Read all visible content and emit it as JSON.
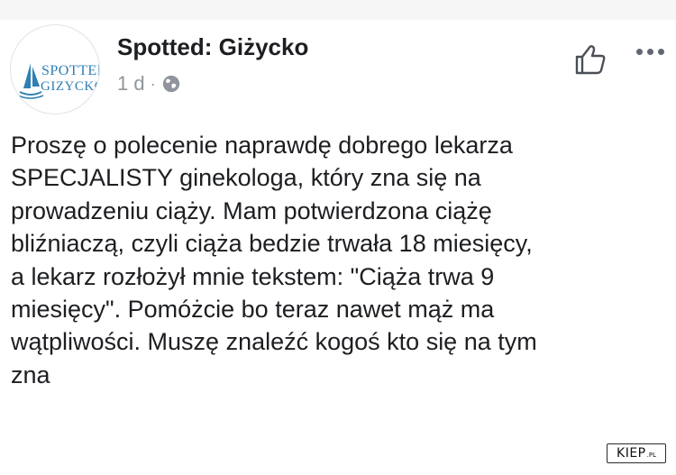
{
  "post": {
    "page_name": "Spotted: Giżycko",
    "time": "1 d",
    "separator": "·",
    "privacy_icon": "globe-icon",
    "avatar": {
      "text_line1": "SPOTTED",
      "text_line2": "GIZYCKO",
      "icon": "sailboat-icon",
      "color": "#2f7fb3"
    },
    "actions": {
      "like_icon": "thumbs-up-icon",
      "more_icon": "more-options-icon"
    },
    "body_lines": [
      "Proszę o polecenie naprawdę dobrego lekarza",
      "SPECJALISTY ginekologa, który zna się na",
      "prowadzeniu ciąży. Mam potwierdzona ciążę",
      "bliźniaczą, czyli ciąża bedzie trwała 18 miesięcy,",
      "a lekarz rozłożył mnie tekstem: \"Ciąża trwa 9",
      "miesięcy\". Pomóżcie bo teraz nawet mąż ma",
      "wątpliwości. Muszę znaleźć kogoś kto się na tym",
      "zna"
    ]
  },
  "watermark": {
    "main": "KIEP",
    "suffix": ".PL"
  }
}
